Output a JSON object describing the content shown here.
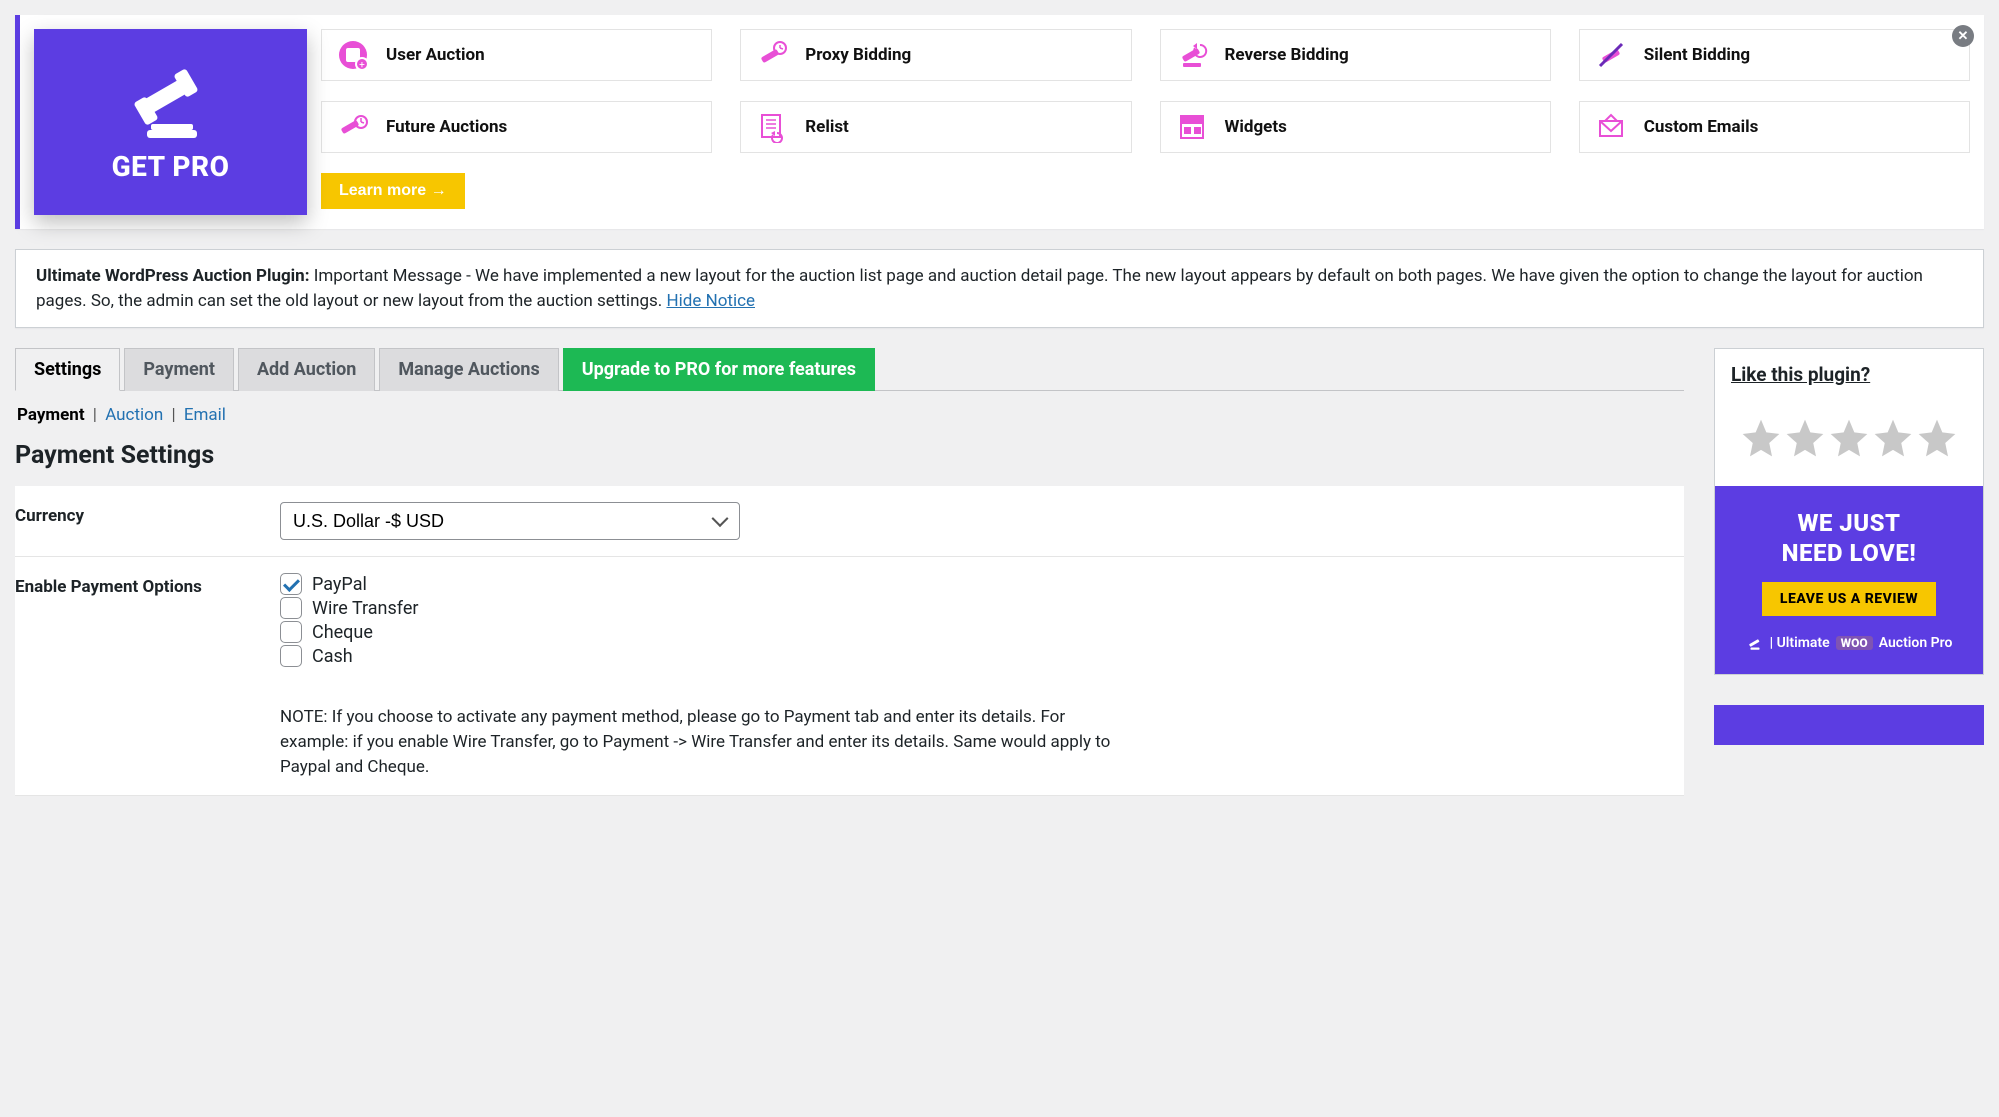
{
  "promo": {
    "title": "GET PRO",
    "learn_more": "Learn more →",
    "features": [
      {
        "label": "User Auction",
        "icon": "user-auction-icon"
      },
      {
        "label": "Proxy Bidding",
        "icon": "proxy-bidding-icon"
      },
      {
        "label": "Reverse Bidding",
        "icon": "reverse-bidding-icon"
      },
      {
        "label": "Silent Bidding",
        "icon": "silent-bidding-icon"
      },
      {
        "label": "Future Auctions",
        "icon": "future-auctions-icon"
      },
      {
        "label": "Relist",
        "icon": "relist-icon"
      },
      {
        "label": "Widgets",
        "icon": "widgets-icon"
      },
      {
        "label": "Custom Emails",
        "icon": "custom-emails-icon"
      }
    ]
  },
  "notice": {
    "prefix": "Ultimate WordPress Auction Plugin:",
    "body": " Important Message - We have implemented a new layout for the auction list page and auction detail page. The new layout appears by default on both pages. We have given the option to change the layout for auction pages. So, the admin can set the old layout or new layout from the auction settings. ",
    "hide": "Hide Notice"
  },
  "tabs": {
    "settings": "Settings",
    "payment": "Payment",
    "add_auction": "Add Auction",
    "manage_auctions": "Manage Auctions",
    "upgrade": "Upgrade to PRO for more features"
  },
  "subtabs": {
    "payment": "Payment",
    "auction": "Auction",
    "email": "Email"
  },
  "heading": "Payment Settings",
  "form": {
    "currency_label": "Currency",
    "currency_value": "U.S. Dollar -$ USD",
    "enable_label": "Enable Payment Options",
    "options": {
      "paypal": {
        "label": "PayPal",
        "checked": true
      },
      "wire": {
        "label": "Wire Transfer",
        "checked": false
      },
      "cheque": {
        "label": "Cheque",
        "checked": false
      },
      "cash": {
        "label": "Cash",
        "checked": false
      }
    },
    "note": "NOTE: If you choose to activate any payment method, please go to Payment tab and enter its details. For example: if you enable Wire Transfer, go to Payment -> Wire Transfer and enter its details. Same would apply to Paypal and Cheque."
  },
  "sidebar": {
    "like": "Like this plugin?",
    "review_line1": "WE JUST",
    "review_line2": "NEED LOVE!",
    "review_button": "LEAVE US A REVIEW",
    "ultimate_prefix": "| Ultimate",
    "ultimate_woo": "WOO",
    "ultimate_suffix": "Auction Pro"
  }
}
